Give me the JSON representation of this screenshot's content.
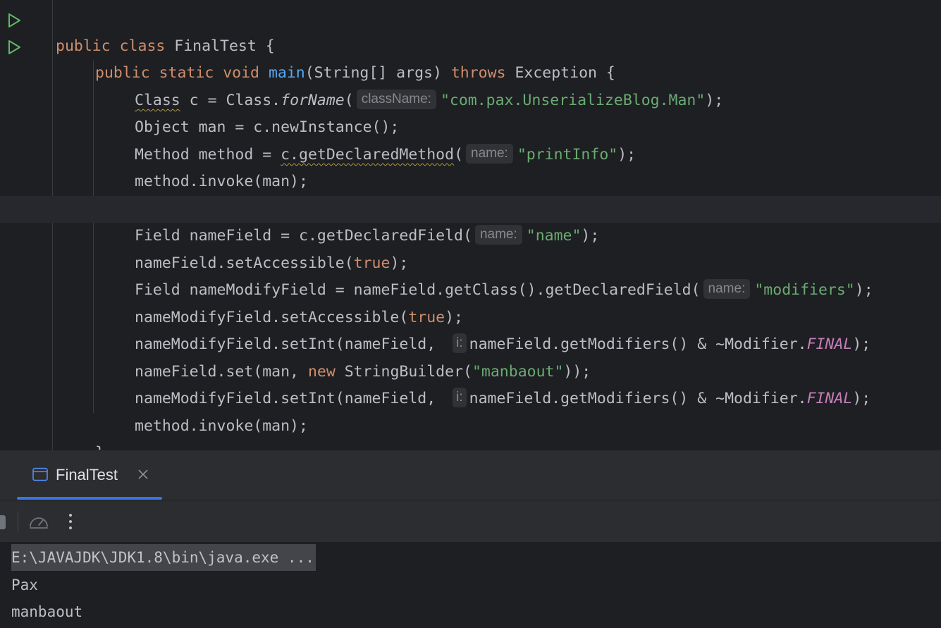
{
  "editor": {
    "lines": [
      {
        "kw1": "public class ",
        "rest": "FinalTest {"
      },
      {
        "kw1": "public static void ",
        "fn": "main",
        "rest": "(String[] args) ",
        "kw2": "throws",
        "rest2": " Exception {"
      },
      {
        "warn": "Class",
        "a": " c = Class.",
        "italic": "forName",
        "b": "(",
        "hint": "className:",
        "str": "\"com.pax.UnserializeBlog.Man\"",
        "c": ");"
      },
      {
        "text": "Object man = c.newInstance();"
      },
      {
        "a": "Method method = ",
        "warn": "c.getDeclaredMethod",
        "b": "(",
        "hint": "name:",
        "str": "\"printInfo\"",
        "c": ");"
      },
      {
        "text": "method.invoke(man);"
      },
      {
        "a": "Field nameField = c.getDeclaredField(",
        "hint": "name:",
        "str": "\"name\"",
        "c": ");"
      },
      {
        "a": "nameField.setAccessible(",
        "kw": "true",
        "c": ");"
      },
      {
        "a": "Field nameModifyField = nameField.getClass().getDeclaredField(",
        "hint": "name:",
        "str": "\"modifiers\"",
        "c": ");"
      },
      {
        "a": "nameModifyField.setAccessible(",
        "kw": "true",
        "c": ");"
      },
      {
        "a": "nameModifyField.setInt(nameField,",
        "hint": "i:",
        "b": "nameField.getModifiers() & ~Modifier.",
        "const": "FINAL",
        "c": ");"
      },
      {
        "a": "nameField.set(man, ",
        "kw": "new",
        "b": " StringBuilder(",
        "str": "\"manbaout\"",
        "c": "));"
      },
      {
        "a": "nameModifyField.setInt(nameField,",
        "hint": "i:",
        "b": "nameField.getModifiers() & ~Modifier.",
        "const": "FINAL",
        "c": ");"
      },
      {
        "text": "method.invoke(man);"
      },
      {
        "text": "}"
      }
    ]
  },
  "run_panel": {
    "tab_label": "FinalTest",
    "console": {
      "command": "E:\\JAVAJDK\\JDK1.8\\bin\\java.exe ...",
      "output": [
        "Pax",
        "manbaout"
      ]
    }
  },
  "colors": {
    "accent": "#3574f0",
    "run_icon": "#5fb865"
  }
}
